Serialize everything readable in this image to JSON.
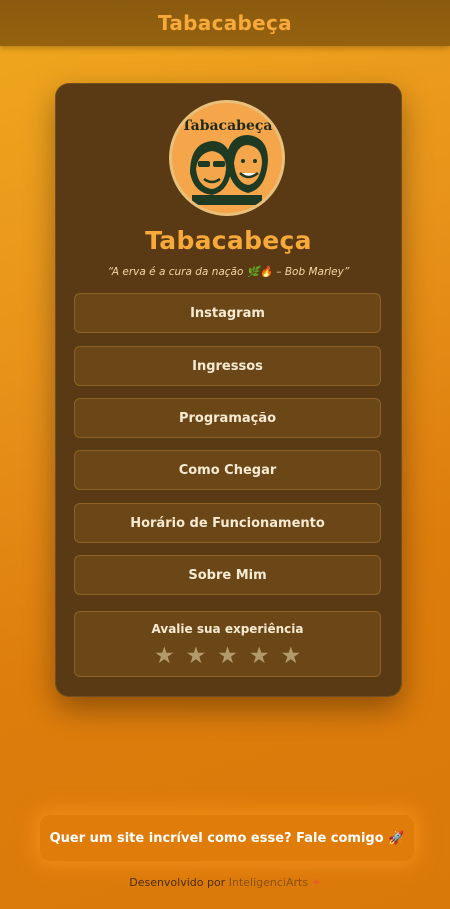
{
  "header": {
    "title": "Tabacabeça"
  },
  "card": {
    "logo_text": "Tabacabeça",
    "brand": "Tabacabeça",
    "quote": "“A erva é a cura da nação 🌿🔥 – Bob Marley”",
    "buttons": [
      {
        "label": "Instagram"
      },
      {
        "label": "Ingressos"
      },
      {
        "label": "Programação"
      },
      {
        "label": "Como Chegar"
      },
      {
        "label": "Horário de Funcionamento"
      },
      {
        "label": "Sobre Mim"
      }
    ],
    "rating": {
      "label": "Avalie sua experiência",
      "max_stars": 5,
      "selected": 0
    }
  },
  "cta": {
    "label": "Quer um site incrível como esse? Fale comigo 🚀"
  },
  "footer": {
    "prefix": "Desenvolvido por",
    "name": "InteligenciArts",
    "spark": "✦"
  },
  "colors": {
    "accent": "#f7a93a",
    "card": "#5a3a14",
    "button": "#6b4717"
  }
}
